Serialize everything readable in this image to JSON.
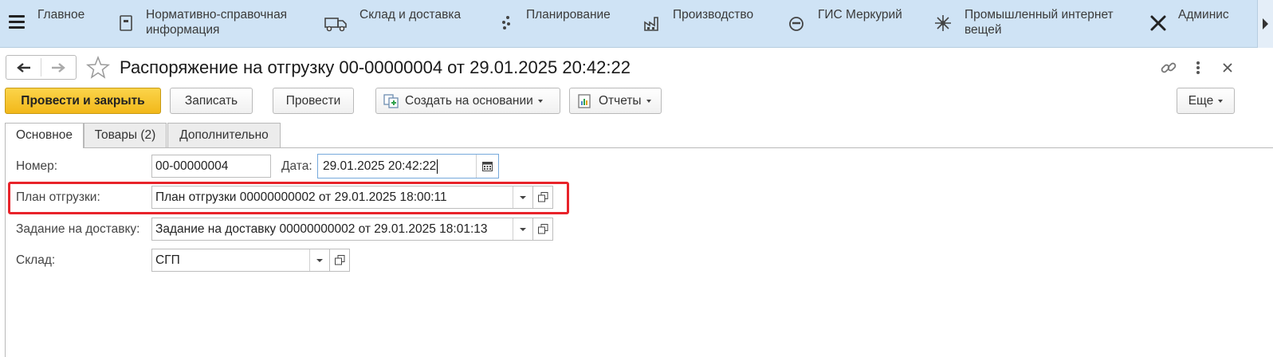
{
  "nav": {
    "items": [
      {
        "label": "Главное",
        "icon": "menu-icon"
      },
      {
        "label": "Нормативно-справочная\nинформация",
        "icon": "book-icon"
      },
      {
        "label": "Склад и доставка",
        "icon": "truck-icon"
      },
      {
        "label": "Планирование",
        "icon": "dots-icon"
      },
      {
        "label": "Производство",
        "icon": "factory-icon"
      },
      {
        "label": "ГИС Меркурий",
        "icon": "compass-icon"
      },
      {
        "label": "Промышленный интернет\nвещей",
        "icon": "network-icon"
      },
      {
        "label": "Админис",
        "icon": "tools-icon"
      }
    ]
  },
  "header": {
    "title": "Распоряжение на отгрузку 00-00000004 от 29.01.2025 20:42:22"
  },
  "toolbar": {
    "post_close": "Провести и закрыть",
    "save": "Записать",
    "post": "Провести",
    "create_based": "Создать на основании",
    "reports": "Отчеты",
    "more": "Еще"
  },
  "tabs": [
    {
      "label": "Основное",
      "active": true
    },
    {
      "label": "Товары (2)",
      "active": false
    },
    {
      "label": "Дополнительно",
      "active": false
    }
  ],
  "form": {
    "number_label": "Номер:",
    "number_value": "00-00000004",
    "date_label": "Дата:",
    "date_value": "29.01.2025 20:42:22",
    "plan_label": "План отгрузки:",
    "plan_value": "План отгрузки 00000000002 от 29.01.2025 18:00:11",
    "task_label": "Задание на доставку:",
    "task_value": "Задание на доставку 00000000002 от 29.01.2025 18:01:13",
    "warehouse_label": "Склад:",
    "warehouse_value": "СГП"
  },
  "colors": {
    "nav_bg": "#cfe3f5",
    "primary_button": "#f2b81a",
    "highlight_border": "#e8232a",
    "focus_border": "#76a9dc"
  }
}
